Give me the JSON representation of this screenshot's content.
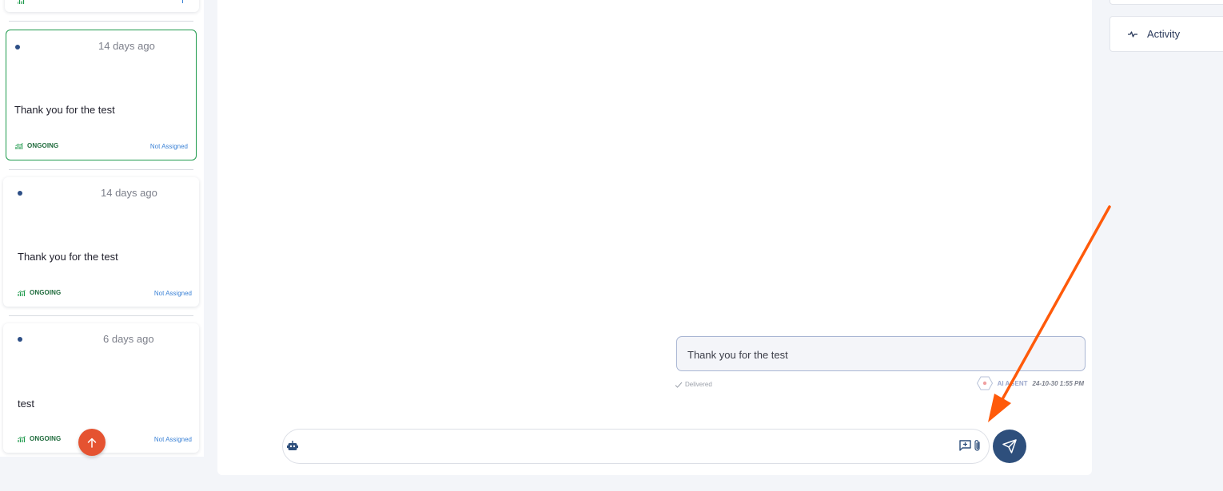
{
  "conversations": [
    {
      "time": "14 days ago",
      "preview": "Thank you for the test",
      "status": "ONGOING",
      "assignment": "Not Assigned",
      "active": true
    },
    {
      "time": "14 days ago",
      "preview": "Thank you for the test",
      "status": "ONGOING",
      "assignment": "Not Assigned",
      "active": false
    },
    {
      "time": "6 days ago",
      "preview": "test",
      "status": "ONGOING",
      "assignment": "Not Assigned",
      "active": false
    }
  ],
  "chat": {
    "message": {
      "text": "Thank you for the test",
      "delivery_status": "Delivered",
      "sender": "AI AGENT",
      "timestamp": "24-10-30 1:55 PM"
    },
    "composer": {
      "placeholder": ""
    }
  },
  "right_panel": {
    "activity_label": "Activity"
  },
  "colors": {
    "accent_green": "#1e9a4c",
    "status_green": "#1f6b3c",
    "link_blue": "#3b82d6",
    "send_button": "#2e4f7c",
    "scroll_button": "#e55331",
    "annotation_arrow": "#ff5a0a"
  },
  "icons": {
    "status": "chart-icon",
    "bot": "robot-icon",
    "canned": "canned-response-icon",
    "attach": "paperclip-icon",
    "send": "send-icon",
    "scroll": "arrow-up-icon",
    "activity": "activity-pulse-icon",
    "delivered": "checkmark-icon",
    "agent": "agent-hex-icon"
  }
}
